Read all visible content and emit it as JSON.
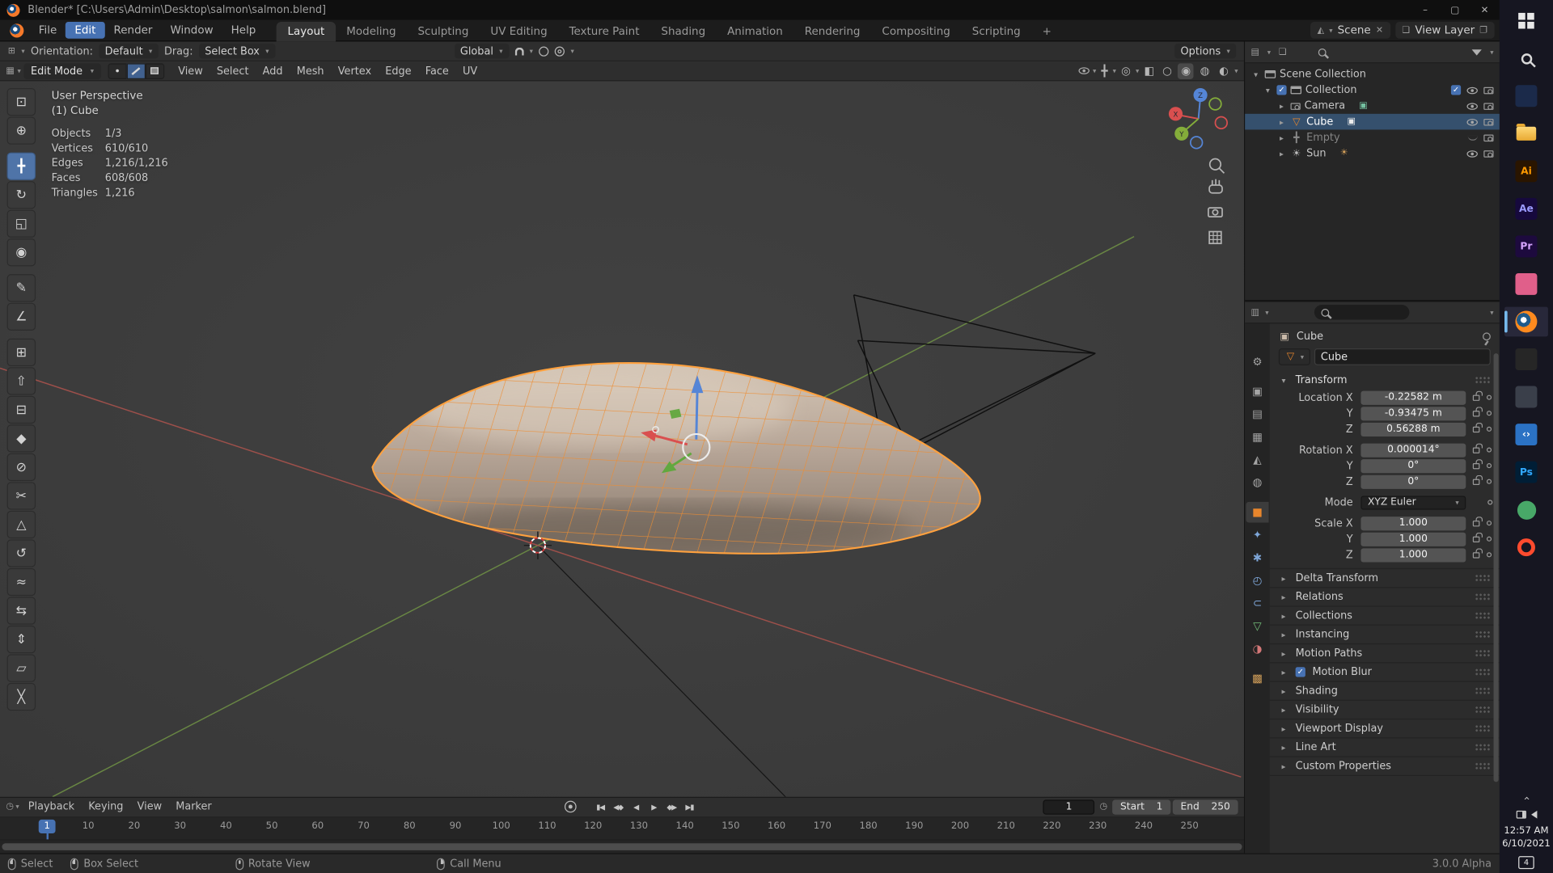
{
  "window": {
    "title": "Blender* [C:\\Users\\Admin\\Desktop\\salmon\\salmon.blend]",
    "minimize_glyph": "–",
    "maximize_glyph": "▢",
    "close_glyph": "✕"
  },
  "colors": {
    "accent_blue": "#4772b3",
    "selection_orange": "#e8862c",
    "wire_orange": "#ee8c30",
    "selected_row_blue": "#35506d"
  },
  "menubar": {
    "menus": [
      {
        "label": "File"
      },
      {
        "label": "Edit",
        "active": true
      },
      {
        "label": "Render"
      },
      {
        "label": "Window"
      },
      {
        "label": "Help"
      }
    ],
    "workspaces": [
      {
        "label": "Layout",
        "active": true
      },
      {
        "label": "Modeling"
      },
      {
        "label": "Sculpting"
      },
      {
        "label": "UV Editing"
      },
      {
        "label": "Texture Paint"
      },
      {
        "label": "Shading"
      },
      {
        "label": "Animation"
      },
      {
        "label": "Rendering"
      },
      {
        "label": "Compositing"
      },
      {
        "label": "Scripting"
      },
      {
        "label": "+"
      }
    ],
    "scene_label": "Scene",
    "view_layer_label": "View Layer"
  },
  "tool_settings": {
    "orientation_label": "Orientation:",
    "orientation_value": "Default",
    "drag_label": "Drag:",
    "drag_value": "Select Box",
    "pivot_value": "Global",
    "options_label": "Options"
  },
  "viewport_header": {
    "mode": "Edit Mode",
    "menus": [
      {
        "label": "View"
      },
      {
        "label": "Select"
      },
      {
        "label": "Add"
      },
      {
        "label": "Mesh"
      },
      {
        "label": "Vertex"
      },
      {
        "label": "Edge"
      },
      {
        "label": "Face"
      },
      {
        "label": "UV"
      }
    ]
  },
  "viewport": {
    "view_label": "User Perspective",
    "object_label": "(1) Cube",
    "stats": [
      {
        "label": "Objects",
        "value": "1/3"
      },
      {
        "label": "Vertices",
        "value": "610/610"
      },
      {
        "label": "Edges",
        "value": "1,216/1,216"
      },
      {
        "label": "Faces",
        "value": "608/608"
      },
      {
        "label": "Triangles",
        "value": "1,216"
      }
    ],
    "axis_x": "X",
    "axis_y": "Y",
    "axis_z": "Z"
  },
  "tools": [
    {
      "name": "select-box-tool",
      "glyph": "⊡"
    },
    {
      "name": "cursor-tool",
      "glyph": "⊕"
    },
    {
      "name": "move-tool",
      "glyph": "╋",
      "active": true,
      "gap": true
    },
    {
      "name": "rotate-tool",
      "glyph": "↻"
    },
    {
      "name": "scale-tool",
      "glyph": "◱"
    },
    {
      "name": "transform-tool",
      "glyph": "◉"
    },
    {
      "name": "annotate-tool",
      "glyph": "✎",
      "gap": true
    },
    {
      "name": "measure-tool",
      "glyph": "∠"
    },
    {
      "name": "add-cube-tool",
      "glyph": "⊞",
      "gap": true
    },
    {
      "name": "extrude-region-tool",
      "glyph": "⇧"
    },
    {
      "name": "inset-faces-tool",
      "glyph": "⊟"
    },
    {
      "name": "bevel-tool",
      "glyph": "◆"
    },
    {
      "name": "loop-cut-tool",
      "glyph": "⊘"
    },
    {
      "name": "knife-tool",
      "glyph": "✂"
    },
    {
      "name": "poly-build-tool",
      "glyph": "△"
    },
    {
      "name": "spin-tool",
      "glyph": "↺"
    },
    {
      "name": "smooth-tool",
      "glyph": "≈"
    },
    {
      "name": "edge-slide-tool",
      "glyph": "⇆"
    },
    {
      "name": "shrink-fatten-tool",
      "glyph": "⇕"
    },
    {
      "name": "shear-tool",
      "glyph": "▱"
    },
    {
      "name": "rip-region-tool",
      "glyph": "╳"
    }
  ],
  "outliner": {
    "rows": [
      {
        "label": "Scene Collection"
      },
      {
        "label": "Collection"
      },
      {
        "label": "Camera"
      },
      {
        "label": "Cube",
        "selected": true
      },
      {
        "label": "Empty",
        "dim": true
      },
      {
        "label": "Sun"
      }
    ]
  },
  "properties": {
    "search_placeholder": "",
    "breadcrumb": "Cube",
    "name_value": "Cube",
    "transform_title": "Transform",
    "location_rows": [
      {
        "label": "Location X",
        "value": "-0.22582 m"
      },
      {
        "label": "Y",
        "value": "-0.93475 m"
      },
      {
        "label": "Z",
        "value": "0.56288 m"
      }
    ],
    "rotation_rows": [
      {
        "label": "Rotation X",
        "value": "0.000014°"
      },
      {
        "label": "Y",
        "value": "0°"
      },
      {
        "label": "Z",
        "value": "0°"
      }
    ],
    "mode_label": "Mode",
    "mode_value": "XYZ Euler",
    "scale_rows": [
      {
        "label": "Scale X",
        "value": "1.000"
      },
      {
        "label": "Y",
        "value": "1.000"
      },
      {
        "label": "Z",
        "value": "1.000"
      }
    ],
    "sections": [
      {
        "label": "Delta Transform"
      },
      {
        "label": "Relations"
      },
      {
        "label": "Collections"
      },
      {
        "label": "Instancing"
      },
      {
        "label": "Motion Paths"
      },
      {
        "label": "Motion Blur",
        "checked": true
      },
      {
        "label": "Shading"
      },
      {
        "label": "Visibility"
      },
      {
        "label": "Viewport Display"
      },
      {
        "label": "Line Art"
      },
      {
        "label": "Custom Properties"
      }
    ],
    "tabs": [
      {
        "name": "tool-tab-icon",
        "glyph": "⚙",
        "color": "#a5a5a5"
      },
      {
        "name": "render-tab-icon",
        "glyph": "▣",
        "color": "#a5a5a5",
        "gap": true
      },
      {
        "name": "output-tab-icon",
        "glyph": "▤",
        "color": "#a5a5a5"
      },
      {
        "name": "view-layer-tab-icon",
        "glyph": "▦",
        "color": "#a5a5a5"
      },
      {
        "name": "scene-tab-icon",
        "glyph": "◭",
        "color": "#a5a5a5"
      },
      {
        "name": "world-tab-icon",
        "glyph": "◍",
        "color": "#a5a5a5"
      },
      {
        "name": "object-tab-icon",
        "glyph": "■",
        "color": "#e8862c",
        "active": true,
        "gap": true
      },
      {
        "name": "modifiers-tab-icon",
        "glyph": "✦",
        "color": "#7ea6d8"
      },
      {
        "name": "particles-tab-icon",
        "glyph": "✱",
        "color": "#7ea6d8"
      },
      {
        "name": "physics-tab-icon",
        "glyph": "◴",
        "color": "#7ea6d8"
      },
      {
        "name": "constraints-tab-icon",
        "glyph": "⊂",
        "color": "#7ea6d8"
      },
      {
        "name": "data-tab-icon",
        "glyph": "▽",
        "color": "#74c07a"
      },
      {
        "name": "material-tab-icon",
        "glyph": "◑",
        "color": "#d47878"
      },
      {
        "name": "texture-tab-icon",
        "glyph": "▩",
        "color": "#d4a05a",
        "gap": true
      }
    ]
  },
  "timeline": {
    "menus": [
      {
        "label": "Playback"
      },
      {
        "label": "Keying"
      },
      {
        "label": "View"
      },
      {
        "label": "Marker"
      }
    ],
    "transport": [
      {
        "name": "jump-to-start-button",
        "glyph": "▮◀"
      },
      {
        "name": "prev-keyframe-button",
        "glyph": "◀◆"
      },
      {
        "name": "play-reverse-button",
        "glyph": "◀"
      },
      {
        "name": "play-button",
        "glyph": "▶"
      },
      {
        "name": "next-keyframe-button",
        "glyph": "◆▶"
      },
      {
        "name": "jump-to-end-button",
        "glyph": "▶▮"
      }
    ],
    "current_frame": "1",
    "playhead_label": "1",
    "start_label": "Start",
    "start_value": "1",
    "end_label": "End",
    "end_value": "250",
    "ticks": [
      "10",
      "20",
      "30",
      "40",
      "50",
      "60",
      "70",
      "80",
      "90",
      "100",
      "110",
      "120",
      "130",
      "140",
      "150",
      "160",
      "170",
      "180",
      "190",
      "200",
      "210",
      "220",
      "230",
      "240",
      "250"
    ]
  },
  "status_bar": {
    "hints": [
      {
        "label": "Select",
        "lmb": true
      },
      {
        "label": "Box Select",
        "lmb": true
      },
      {
        "label": "Rotate View",
        "mmb": true
      },
      {
        "label": "Call Menu",
        "rmb": true
      }
    ],
    "version": "3.0.0 Alpha"
  },
  "taskbar": {
    "illustrator_label": "Ai",
    "after_effects_label": "Ae",
    "premiere_label": "Pr",
    "photoshop_label": "Ps",
    "vscode_label": "‹›",
    "clock_time": "12:57 AM",
    "clock_date": "6/10/2021",
    "notification_badge": "4"
  }
}
